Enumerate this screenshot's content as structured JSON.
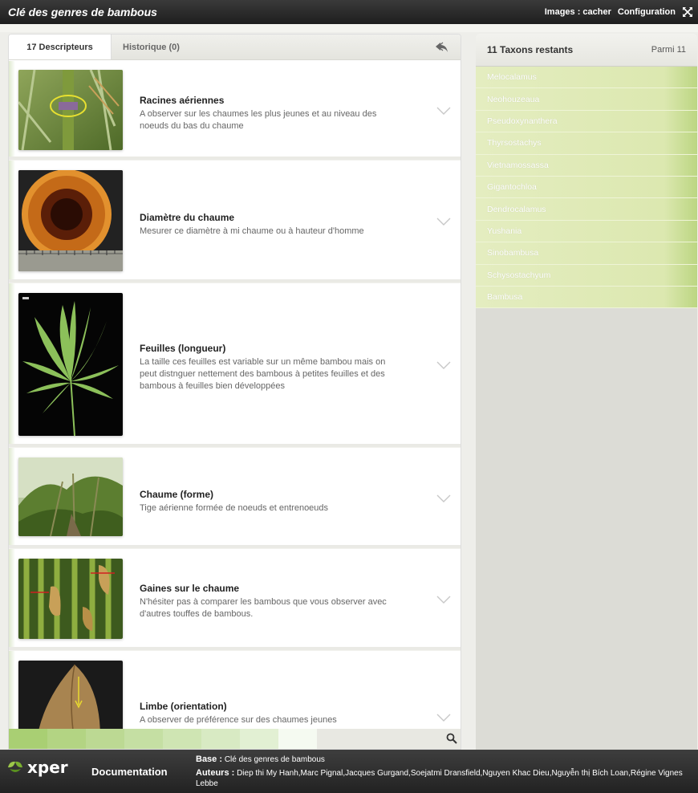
{
  "header": {
    "title": "Clé des genres de bambous",
    "images_label": "Images : cacher",
    "config_label": "Configuration"
  },
  "left_panel": {
    "tabs": [
      {
        "label": "17 Descripteurs"
      },
      {
        "label": "Historique (0)"
      }
    ],
    "descriptors": [
      {
        "name": "Racines aériennes",
        "text": "A observer sur les chaumes les plus jeunes et au niveau des noeuds du bas du chaume",
        "icon": "aerial-roots-photo"
      },
      {
        "name": "Diamètre du chaume",
        "text": "Mesurer ce diamètre à mi chaume ou à hauteur d'homme",
        "icon": "culm-diameter-photo"
      },
      {
        "name": "Feuilles (longueur)",
        "text": "La taille ces feuilles est variable sur un même bambou mais on peut distnguer nettement des bambous à petites feuilles et des bambous à feuilles bien développées",
        "icon": "leaves-photo"
      },
      {
        "name": "Chaume (forme)",
        "text": "Tige aérienne formée de noeuds et entrenoeuds",
        "icon": "culm-shape-photo"
      },
      {
        "name": "Gaines sur le chaume",
        "text": "N'hésiter pas à comparer les bambous que vous observer avec d'autres touffes de bambous.",
        "icon": "culm-sheaths-photo"
      },
      {
        "name": "Limbe (orientation)",
        "text": "A observer de préférence sur des chaumes jeunes",
        "icon": "leaf-blade-photo"
      }
    ],
    "colorbar": [
      "#a9cf73",
      "#b3d483",
      "#bcd993",
      "#c5dfa3",
      "#cfe5b3",
      "#d8eac3",
      "#e2f0d3",
      "#ebf5e3",
      "#f5faf1"
    ]
  },
  "right_panel": {
    "title": "11 Taxons restants",
    "parmi": "Parmi 11",
    "taxa": [
      "Melocalamus",
      "Neohouzeaua",
      "Pseudoxynanthera",
      "Thyrsostachys",
      "Vietnamossassa",
      "Gigantochloa",
      "Dendrocalamus",
      "Yushania",
      "Sinobambusa",
      "Schysostachyum",
      "Bambusa"
    ]
  },
  "footer": {
    "logo_text": "xper",
    "documentation": "Documentation",
    "base_label": "Base :",
    "base_value": "Clé des genres de bambous",
    "authors_label": "Auteurs :",
    "authors_value": "Diep thi My Hanh,Marc Pignal,Jacques Gurgand,Soejatmi Dransfield,Nguyen Khac Dieu,Nguyễn thị Bích Loan,Régine Vignes Lebbe"
  },
  "colors": {
    "accent_green": "#c7dc94",
    "header_dark": "#2a2a2a"
  }
}
